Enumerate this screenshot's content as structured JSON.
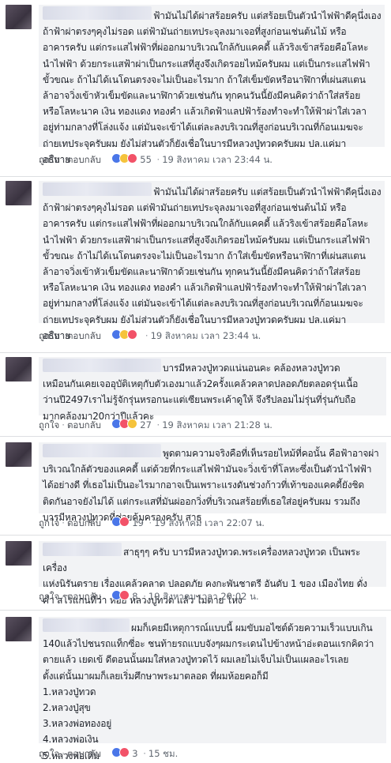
{
  "ui": {
    "like": "ถูกใจ",
    "reply": "ตอบกลับ",
    "dot": "·"
  },
  "comments": [
    {
      "text": "ฟ้ามันไม่ได้ผ่าสร้อยครับ แต่สร้อยเป็นตัวนำไฟฟ้าดีคุนึ่งเอง\nถ้าฟ้าผ่าตรงๆคุงไม่รอด แต่ฟ้ามันถ่ายเทประจุลงมาเจอที่สูงก่อนเช่นต้นไม้ หรือ\nอาคารครับ แต่กระแสไฟฟ้าที่ผ่ออกมาบริเวณใกล้กับแคคดี้ แล้วริงเข้าสร้อยคือโลหะ\nนำไฟฟ้า ด้วยกระแสฟ้าผ่าเป็นกระแสที่สูงจึงเกิดรอยไหม้ครับผม แต่เป็นกระแสไฟฟ้า\nขั้วขณะ ถ้าไม่ได้เนโดนตรงจะไม่เป็นอะไรมาก ถ้าใส่เข็มขัดหรือนาฬิกาที่เผ่นสแตน\nล้าอาจวิ่งเข้าหัวเข็มขัดและนาฬิกาด้วยเช่นกัน ทุกคนวันนี้ยังมีคนคิดว่าถ้าใส่สร้อย\nหรือโลหะนาค เงิน ทองแดง ทองคำ แล้วเกิดฟ้าแลปฟ้าร้องทำจะทำให้ฟ้าผ่าใส่เวลา\nอยู่ท่ามกลางที่โล่งแจ้ง แต่มันจะเข้าได้แต่ละลงบริเวณที่สูงก่อนบริเวณที่ก้อนเมฆจะ\nถ่ายเทประจุครับผม ยังไม่ส่วนตัวก็ยังเชื่อในบารมีหลวงปู่ทวดครับผม ปล.แค่มา\nอธิบาย",
      "reactions": "55",
      "time": "19 สิงหาคม เวลา 23:44 น."
    },
    {
      "text": "ฟ้ามันไม่ได้ผ่าสร้อยครับ แต่สร้อยเป็นตัวนำไฟฟ้าดีคุนึ่งเอง\nถ้าฟ้าผ่าตรงๆคุงไม่รอด แต่ฟ้ามันถ่ายเทประจุลงมาเจอที่สูงก่อนเช่นต้นไม้ หรือ\nอาคารครับ แต่กระแสไฟฟ้าที่ผ่ออกมาบริเวณใกล้กับแคคดี้ แล้วริงเข้าสร้อยคือโลหะ\nนำไฟฟ้า ด้วยกระแสฟ้าผ่าเป็นกระแสที่สูงจึงเกิดรอยไหม้ครับผม แต่เป็นกระแสไฟฟ้า\nขั้วขณะ ถ้าไม่ได้เนโดนตรงจะไม่เป็นอะไรมาก ถ้าใส่เข็มขัดหรือนาฬิกาที่เผ่นสแตน\nล้าอาจวิ่งเข้าหัวเข็มขัดและนาฬิกาด้วยเช่นกัน ทุกคนวันนี้ยังมีคนคิดว่าถ้าใส่สร้อย\nหรือโลหะนาค เงิน ทองแดง ทองคำ แล้วเกิดฟ้าแลปฟ้าร้องทำจะทำให้ฟ้าผ่าใส่เวลา\nอยู่ท่ามกลางที่โล่งแจ้ง แต่มันจะเข้าได้แต่ละลงบริเวณที่สูงก่อนบริเวณที่ก้อนเมฆจะ\nถ่ายเทประจุครับผม ยังไม่ส่วนตัวก็ยังเชื่อในบารมีหลวงปู่ทวดครับผม ปล.แค่มา\nอธิบาย",
      "reactions": "",
      "time": "19 สิงหาคม เวลา 23:44 น."
    },
    {
      "text": "บารมีหลวงปู่ทวดแน่นอนคะ คล้องหลวงปู่ทวด\nเหมือนกันเคยเจออุบัติเหตุกับตัวเองมาแล้ว2ครั้งแคล้วคลาดปลอดภัยตลอดรุ่นเนื้อ\nว่านปี2497เราไม่รู้จักรุ่นหรอกนะแต่เซียนพระเค้าดูให้ จึงรีปลอมไม่รุ่นที่รุ่นกับถือ\nมากคล้องมา20กว่าปีแล้วคะ",
      "reactions": "27",
      "time": "19 สิงหาคม เวลา 21:28 น."
    },
    {
      "text": "พูดตามความจริงคือที่เห็นรอยไหม้ที่คอนั้น คือฟ้าอาจผ่า\nบริเวณใกล้ตัวของแคคดี้ แต่ด้วยที่กระแสไฟฟ้ามันจะวิ่งเข้าที่โลหะซึ่งเป็นตัวนำไฟฟ้า\nได้อย่างดี ที่เธอไม่เป็นอะไรมากอาจเป็นเพราะแรงดันช่วงก้าวที่เท้าของแคคดี้ยังชิด\nติดกันอาจยังไม่ได้ แต่กระแสที่มันผ่ออกวิ่งที่บริเวณสร้อยที่เธอใส่อยู่ครับผม รวมถึง\nบารมีหลวงปู่ทวดที่ช่วยคุ้มครองครับ สาธุ",
      "reactions": "19",
      "time": "19 สิงหาคม เวลา 22:07 น."
    },
    {
      "text": "สาธุๆๆ ครับ บารมีหลวงปู่ทวด.พระเครื่องหลวงปู่ทวด เป็นพระเครื่อง\nแห่งนิรันตราย เรื่องแคล้วคลาด ปลอดภัย คงกะพันชาตรี อันดับ 1 ของ เมืองไทย ดั่ง\nคำ สโรแกนที่ว่า ห้อย หลวงปู่ทวด แล้ว ไม่ตาย โหง",
      "reactions": "8",
      "time": "19 สิงหาคม เวลา 20:02 น."
    },
    {
      "text": "ผมก็เคยมีเหตุการณ์แบบนี้ ผมขับมอไซต์ด้วยความเร็วแบบเกิน\n140แล้วไปชนรถแท็กซี่อะ ชนท้ายรถแบบจังๆผมกระเดนไปข้างหน้าอ่ะตอนแรกคิดว่า\nตายแล้ว เยดเข้ ดีตอนนั้นผมใส่หลวงปู่ทวดไว้ ผมเลยไม่เจ็บไม่เป็นแผลอะไรเลย\nตั้งแต่นั้นมาผมก็เลยเริ่มศึกษาพระมาตลอด ที่ผมห้อยคอก็มี\n1.หลวงปู่ทวด\n2.หลวงปู่สุข\n3.หลวงพ่อทองอยู่\n4.หลวงพ่อเงิน\n5.หลวงพ่อเดิม",
      "reactions": "3",
      "time": "15 ชม."
    }
  ]
}
